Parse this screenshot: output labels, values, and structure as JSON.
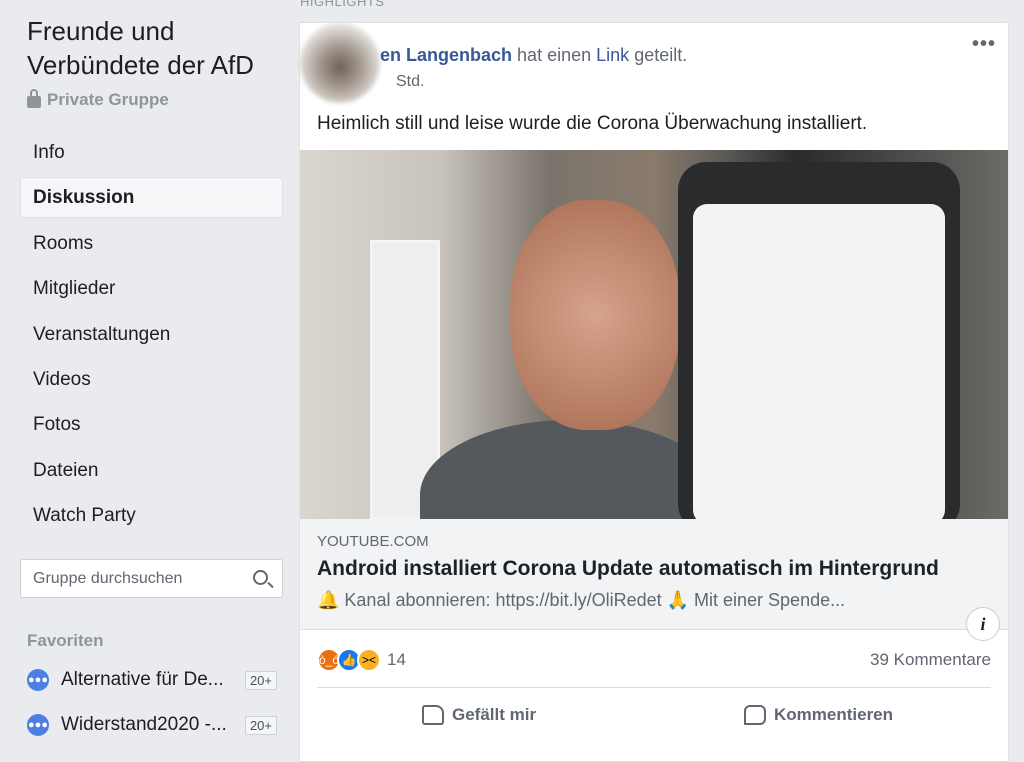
{
  "group": {
    "title": "Freunde und Verbündete der AfD",
    "privacy": "Private Gruppe"
  },
  "nav": [
    {
      "label": "Info"
    },
    {
      "label": "Diskussion",
      "active": true
    },
    {
      "label": "Rooms"
    },
    {
      "label": "Mitglieder"
    },
    {
      "label": "Veranstaltungen"
    },
    {
      "label": "Videos"
    },
    {
      "label": "Fotos"
    },
    {
      "label": "Dateien"
    },
    {
      "label": "Watch Party"
    }
  ],
  "search": {
    "placeholder": "Gruppe durchsuchen"
  },
  "favorites": {
    "label": "Favoriten",
    "items": [
      {
        "name": "Alternative für De...",
        "badge": "20+"
      },
      {
        "name": "Widerstand2020 -...",
        "badge": "20+"
      }
    ]
  },
  "highlights_label": "HIGHLIGHTS",
  "post": {
    "author": "en Langenbach",
    "action_pre": "hat einen",
    "action_link": "Link",
    "action_post": "geteilt.",
    "time": "Std.",
    "text": "Heimlich still und leise wurde die Corona Überwachung installiert.",
    "link": {
      "domain": "YOUTUBE.COM",
      "title": "Android installiert Corona Update automatisch im Hintergrund",
      "description": "🔔 Kanal abonnieren: https://bit.ly/OliRedet 🙏 Mit einer Spende..."
    },
    "reaction_count": "14",
    "comments": "39 Kommentare",
    "like_label": "Gefällt mir",
    "comment_label": "Kommentieren"
  },
  "colors": {
    "link": "#385898",
    "accent": "#4d7fe0"
  }
}
